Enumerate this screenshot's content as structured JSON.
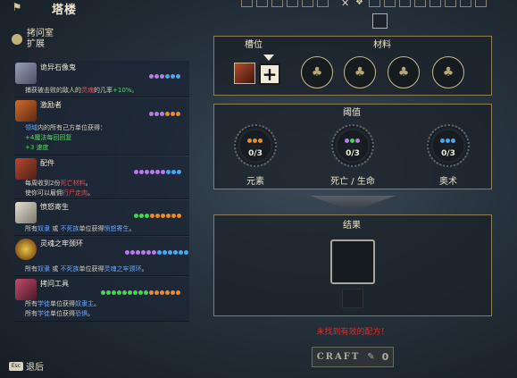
{
  "header": {
    "title": "塔楼"
  },
  "section": {
    "title": "拷问室",
    "subtitle": "扩展"
  },
  "recipes": [
    {
      "name": "诡异石像鬼",
      "desc1_a": "捕获被击败的敌人的",
      "desc1_b": "灵魂",
      "desc1_c": "的几率",
      "desc1_d": "+10%。",
      "dots": [
        "p",
        "p",
        "p",
        "b",
        "b",
        "b"
      ]
    },
    {
      "name": "激励者",
      "desc1_a": "领域",
      "desc1_b": "内的所有己方单位获得：",
      "desc2": "+4魔法每回回复",
      "desc3": "+3 速度",
      "dots": [
        "p",
        "p",
        "p",
        "o",
        "o",
        "o"
      ]
    },
    {
      "name": "配件",
      "desc1_a": "每周收到2份",
      "desc1_b": "死亡材料",
      "desc1_c": "。",
      "desc2_a": "使你可以雇佣",
      "desc2_b": "行尸走肉",
      "desc2_c": "。",
      "dots": [
        "p",
        "p",
        "p",
        "p",
        "p",
        "p",
        "b",
        "b",
        "b"
      ]
    },
    {
      "name": "愤怒寄生",
      "desc1_a": "所有",
      "desc1_b": "奴隶",
      "desc1_c": "或",
      "desc1_d": "不死族",
      "desc1_e": "单位获得",
      "desc1_f": "愤怒寄生",
      "desc1_g": "。",
      "dots": [
        "g",
        "g",
        "g",
        "o",
        "o",
        "o",
        "o",
        "o",
        "o"
      ]
    },
    {
      "name": "灵魂之牢颈环",
      "desc1_a": "所有",
      "desc1_b": "奴隶",
      "desc1_c": "或",
      "desc1_d": "不死族",
      "desc1_e": "单位获得",
      "desc1_f": "灵魂之牢颈环",
      "desc1_g": "。",
      "dots": [
        "p",
        "p",
        "p",
        "p",
        "p",
        "p",
        "b",
        "b",
        "b",
        "b",
        "b",
        "b"
      ]
    },
    {
      "name": "拷问工具",
      "desc1_a": "所有",
      "desc1_b": "学徒",
      "desc1_c": "单位获得",
      "desc1_d": "奴隶主",
      "desc1_e": "。",
      "desc2_a": "所有",
      "desc2_b": "学徒",
      "desc2_c": "单位获得",
      "desc2_d": "恐惧",
      "desc2_e": "。",
      "dots": [
        "g",
        "g",
        "g",
        "g",
        "g",
        "g",
        "g",
        "g",
        "g",
        "o",
        "o",
        "o",
        "o",
        "o",
        "o"
      ]
    }
  ],
  "slot_panel": {
    "slot_label": "槽位",
    "materials_label": "材料",
    "add_icon": "plus-icon"
  },
  "threshold_panel": {
    "title": "阈值",
    "items": [
      {
        "label": "元素",
        "count": "0/3",
        "dots": [
          "o",
          "o",
          "o"
        ]
      },
      {
        "label": "死亡 / 生命",
        "count": "0/3",
        "dots": [
          "p",
          "g",
          "p"
        ]
      },
      {
        "label": "奥术",
        "count": "0/3",
        "dots": [
          "b",
          "b",
          "b"
        ]
      }
    ]
  },
  "result_panel": {
    "title": "结果"
  },
  "error": "未找到有效的配方！",
  "craft": {
    "label": "Craft",
    "count": "0"
  },
  "back": {
    "key": "Esc",
    "label": "退后"
  },
  "colors": {
    "purple": "#b77ce6",
    "blue": "#46a8f0",
    "orange": "#ef8a2a",
    "green": "#41d94a",
    "panel_border": "#8c7e55",
    "error": "#d2322a"
  }
}
